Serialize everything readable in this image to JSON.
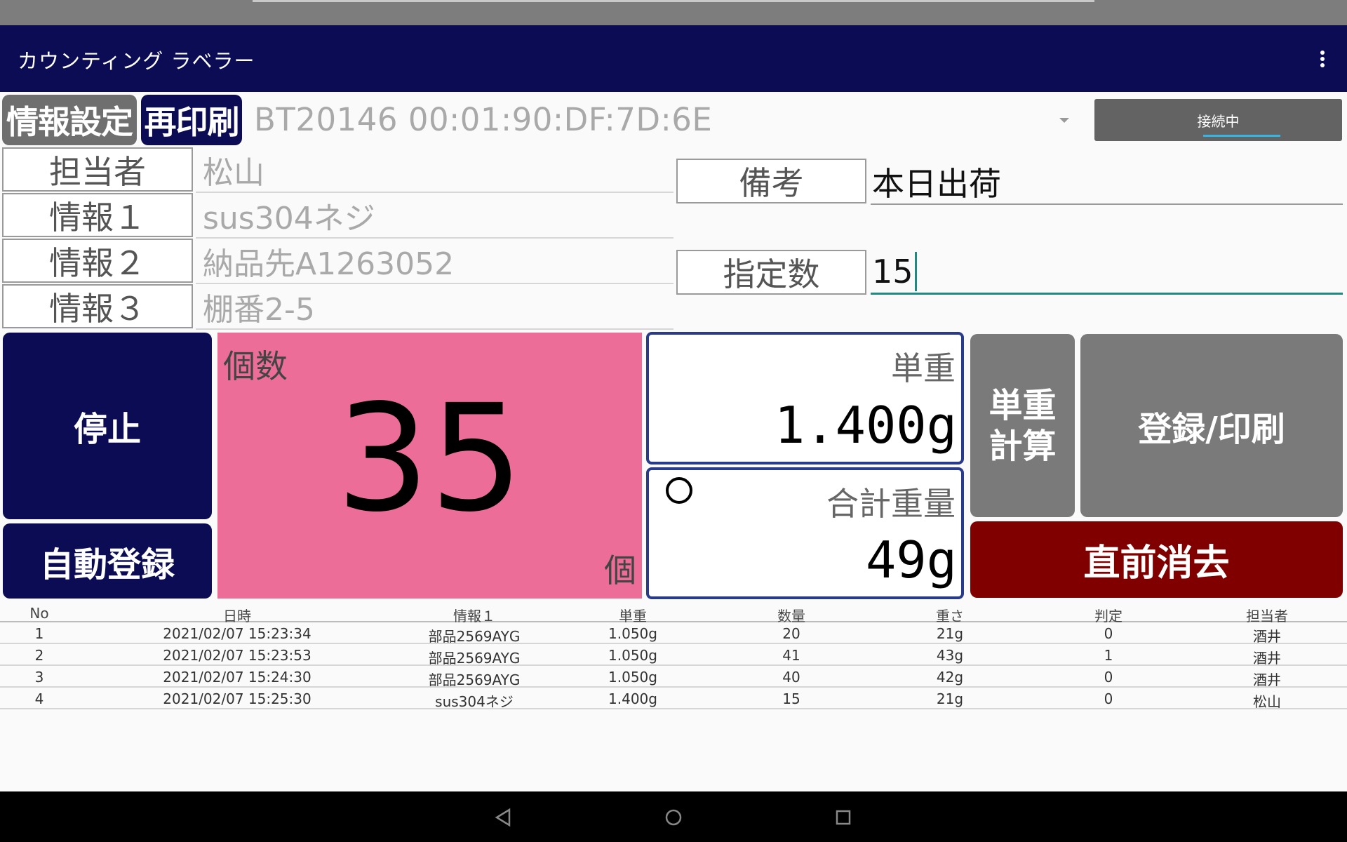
{
  "app": {
    "title": "カウンティング ラベラー"
  },
  "toolbar": {
    "info_settings_label": "情報設定",
    "reprint_label": "再印刷",
    "device": "BT20146 00:01:90:DF:7D:6E",
    "connection_label": "接続中"
  },
  "info": {
    "rows": [
      {
        "label": "担当者",
        "value": "松山"
      },
      {
        "label": "情報１",
        "value": "sus304ネジ"
      },
      {
        "label": "情報２",
        "value": "納品先A1263052"
      },
      {
        "label": "情報３",
        "value": "棚番2-5"
      }
    ]
  },
  "remarks": {
    "label": "備考",
    "value": "本日出荷"
  },
  "target_count": {
    "label": "指定数",
    "value": "15"
  },
  "buttons": {
    "stop": "停止",
    "auto_register": "自動登録",
    "unit_weight_calc": "単重\n計算",
    "register_print": "登録/印刷",
    "undo_last": "直前消去"
  },
  "count": {
    "heading": "個数",
    "value": "35",
    "unit": "個"
  },
  "unit_weight": {
    "heading": "単重",
    "value": "1.400g"
  },
  "total_weight": {
    "heading": "合計重量",
    "value": "49g",
    "stable": true
  },
  "records": {
    "columns": [
      "No",
      "日時",
      "情報１",
      "単重",
      "数量",
      "重さ",
      "判定",
      "担当者"
    ],
    "rows": [
      [
        "1",
        "2021/02/07 15:23:34",
        "部品2569AYG",
        "1.050g",
        "20",
        "21g",
        "0",
        "酒井"
      ],
      [
        "2",
        "2021/02/07 15:23:53",
        "部品2569AYG",
        "1.050g",
        "41",
        "43g",
        "1",
        "酒井"
      ],
      [
        "3",
        "2021/02/07 15:24:30",
        "部品2569AYG",
        "1.050g",
        "40",
        "42g",
        "0",
        "酒井"
      ],
      [
        "4",
        "2021/02/07 15:25:30",
        "sus304ネジ",
        "1.400g",
        "15",
        "21g",
        "0",
        "松山"
      ]
    ]
  },
  "colors": {
    "app_bar": "#0c0c55",
    "count_panel": "#ec6d98",
    "undo_button": "#800000",
    "grey_button": "#7a7a7a",
    "accent_teal": "#1f8a82"
  },
  "icons": {
    "overflow_menu": "more-vert-icon",
    "dropdown": "dropdown-caret-icon",
    "stable": "stable-circle-icon",
    "nav": [
      "back-icon",
      "home-icon",
      "recents-icon"
    ]
  }
}
